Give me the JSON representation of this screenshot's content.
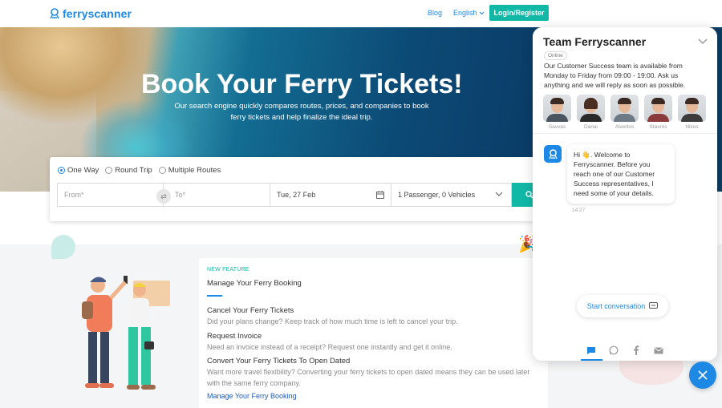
{
  "header": {
    "logo_text": "ferryscanner",
    "nav_blog": "Blog",
    "nav_language": "English",
    "login_label": "Login/Register"
  },
  "hero": {
    "title": "Book Your Ferry Tickets!",
    "subtitle": "Our search engine quickly compares routes, prices, and companies to book ferry tickets and help finalize the ideal trip."
  },
  "search": {
    "trip_types": [
      {
        "label": "One Way",
        "selected": true
      },
      {
        "label": "Round Trip",
        "selected": false
      },
      {
        "label": "Multiple Routes",
        "selected": false
      }
    ],
    "from_placeholder": "From*",
    "to_placeholder": "To*",
    "date_value": "Tue, 27 Feb",
    "passengers_value": "1 Passenger, 0 Vehicles"
  },
  "feature": {
    "label": "NEW FEATURE",
    "title": "Manage Your Ferry Booking",
    "items": [
      {
        "title": "Cancel Your Ferry Tickets",
        "desc": "Did your plans change? Keep track of how much time is left to cancel your trip."
      },
      {
        "title": "Request Invoice",
        "desc": "Need an invoice instead of a receipt? Request one instantly and get it online."
      },
      {
        "title": "Convert Your Ferry Tickets To Open Dated",
        "desc": "Want more travel flexibility? Converting your ferry tickets to open dated means they can be used later with the same ferry company."
      }
    ],
    "link": "Manage Your Ferry Booking"
  },
  "chat": {
    "title": "Team Ferryscanner",
    "status": "Online",
    "intro": "Our Customer Success team is available from Monday to Friday from 09:00 - 19:00. Ask us anything and we will reply as soon as possible.",
    "agents": [
      "Savvas",
      "Danai",
      "Alvertos",
      "Stavros",
      "Nikos"
    ],
    "message": "Hi 👋. Welcome to Ferryscanner. Before you reach one of our Customer Success representatives, I need some of your details.",
    "message_time": "14:27",
    "start_label": "Start conversation"
  },
  "colors": {
    "brand_blue": "#1e88e5",
    "brand_teal": "#12b8a6"
  }
}
